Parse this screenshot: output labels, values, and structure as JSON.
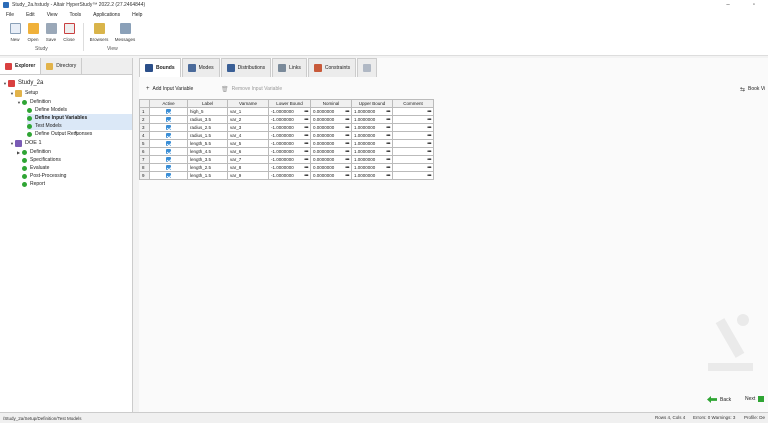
{
  "window": {
    "title": "Study_2a.hstudy - Altair HyperStudy™ 2022.2 (27.2464844)"
  },
  "menu": [
    "File",
    "Edit",
    "View",
    "Tools",
    "Applications",
    "Help"
  ],
  "ribbon": {
    "study_buttons": [
      {
        "label": "New",
        "icon": "new-document-icon",
        "color": "#e8eef7"
      },
      {
        "label": "Open",
        "icon": "open-folder-icon",
        "color": "#f0b13a"
      },
      {
        "label": "Save",
        "icon": "save-icon",
        "color": "#9aa8b8"
      },
      {
        "label": "Close",
        "icon": "close-study-icon",
        "color": "#c94040"
      }
    ],
    "view_buttons": [
      {
        "label": "Browsers",
        "icon": "browsers-icon",
        "color": "#d9b44a"
      },
      {
        "label": "Messages",
        "icon": "messages-icon",
        "color": "#8aa0b8"
      }
    ],
    "study_group_label": "Study",
    "view_group_label": "View"
  },
  "left_tabs": [
    {
      "label": "Explorer",
      "active": true,
      "icon": "explorer-icon"
    },
    {
      "label": "Directory",
      "active": false,
      "icon": "directory-icon"
    }
  ],
  "tree": [
    {
      "label": "Study_2a",
      "level": 0,
      "type": "study"
    },
    {
      "label": "Setup",
      "level": 1,
      "type": "folder"
    },
    {
      "label": "Definition",
      "level": 2,
      "type": "check"
    },
    {
      "label": "Define Models",
      "level": 3,
      "type": "check"
    },
    {
      "label": "Define Input Variables",
      "level": 3,
      "type": "check",
      "selected": true,
      "bold": true
    },
    {
      "label": "Test Models",
      "level": 3,
      "type": "check",
      "selected": true
    },
    {
      "label": "Define Output Responses",
      "level": 3,
      "type": "check"
    },
    {
      "label": "DOE 1",
      "level": 1,
      "type": "doe"
    },
    {
      "label": "Definition",
      "level": 2,
      "type": "check"
    },
    {
      "label": "Specifications",
      "level": 2,
      "type": "check"
    },
    {
      "label": "Evaluate",
      "level": 2,
      "type": "check"
    },
    {
      "label": "Post-Processing",
      "level": 2,
      "type": "check"
    },
    {
      "label": "Report",
      "level": 2,
      "type": "check"
    }
  ],
  "workspace_tabs": [
    {
      "label": "Bounds",
      "active": true,
      "icon": "bounds-icon"
    },
    {
      "label": "Modes",
      "active": false,
      "icon": "modes-icon"
    },
    {
      "label": "Distributions",
      "active": false,
      "icon": "distributions-icon"
    },
    {
      "label": "Links",
      "active": false,
      "icon": "links-icon"
    },
    {
      "label": "Constraints",
      "active": false,
      "icon": "constraints-icon"
    },
    {
      "label": "",
      "active": false,
      "icon": "table-view-icon"
    }
  ],
  "toolbar": {
    "add_label": "Add Input Variable",
    "remove_label": "Remove Input Variable",
    "right_label": "Book Vi"
  },
  "table": {
    "headers": [
      "",
      "Active",
      "Label",
      "Varname",
      "Lower Bound",
      "Nominal",
      "Upper Bound",
      "Comment"
    ],
    "rows": [
      {
        "idx": "1",
        "label": "high_5",
        "varname": "var_1",
        "lower": "-1.0000000",
        "nominal": "0.0000000",
        "upper": "1.0000000"
      },
      {
        "idx": "2",
        "label": "radius_3.5",
        "varname": "var_2",
        "lower": "-1.0000000",
        "nominal": "0.0000000",
        "upper": "1.0000000"
      },
      {
        "idx": "3",
        "label": "radius_2.5",
        "varname": "var_3",
        "lower": "-1.0000000",
        "nominal": "0.0000000",
        "upper": "1.0000000"
      },
      {
        "idx": "4",
        "label": "radius_1.5",
        "varname": "var_4",
        "lower": "-1.0000000",
        "nominal": "0.0000000",
        "upper": "1.0000000"
      },
      {
        "idx": "5",
        "label": "length_5.5",
        "varname": "var_5",
        "lower": "-1.0000000",
        "nominal": "0.0000000",
        "upper": "1.0000000"
      },
      {
        "idx": "6",
        "label": "length_4.5",
        "varname": "var_6",
        "lower": "-1.0000000",
        "nominal": "0.0000000",
        "upper": "1.0000000"
      },
      {
        "idx": "7",
        "label": "length_3.5",
        "varname": "var_7",
        "lower": "-1.0000000",
        "nominal": "0.0000000",
        "upper": "1.0000000"
      },
      {
        "idx": "8",
        "label": "length_2.5",
        "varname": "var_8",
        "lower": "-1.0000000",
        "nominal": "0.0000000",
        "upper": "1.0000000"
      },
      {
        "idx": "9",
        "label": "length_1.5",
        "varname": "var_9",
        "lower": "-1.0000000",
        "nominal": "0.0000000",
        "upper": "1.0000000"
      }
    ]
  },
  "nav": {
    "back_label": "Back",
    "next_label": "Next"
  },
  "status": {
    "path": "/Study_2a/Setup/Definition/Test Models",
    "rows_cols": "Rows 4, Cols 4",
    "errors_warnings": "Errors: 0  Warnings: 3",
    "profile": "Profile: De"
  },
  "colors": {
    "accent": "#2b6cb8",
    "check": "#2fa534",
    "selected": "#dbe8f7"
  }
}
